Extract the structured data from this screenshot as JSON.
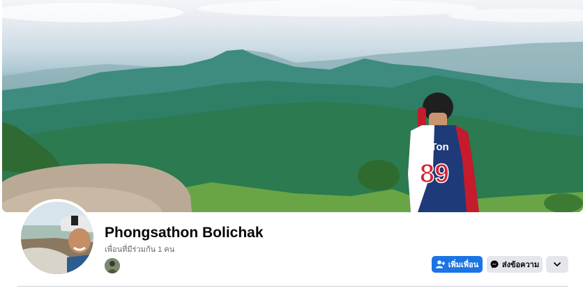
{
  "profile": {
    "name": "Phongsathon Bolichak",
    "mutual_friends_text": "เพื่อนที่มีร่วมกัน 1 คน"
  },
  "cover": {
    "jersey_name": "B.Ton",
    "jersey_number": "89"
  },
  "actions": {
    "add_friend_label": "เพิ่มเพื่อน",
    "message_label": "ส่งข้อความ",
    "more_icon": "chevron-down-icon"
  },
  "colors": {
    "primary": "#1b74e4",
    "secondary": "#e4e6eb",
    "text": "#050505",
    "muted": "#65676b"
  }
}
